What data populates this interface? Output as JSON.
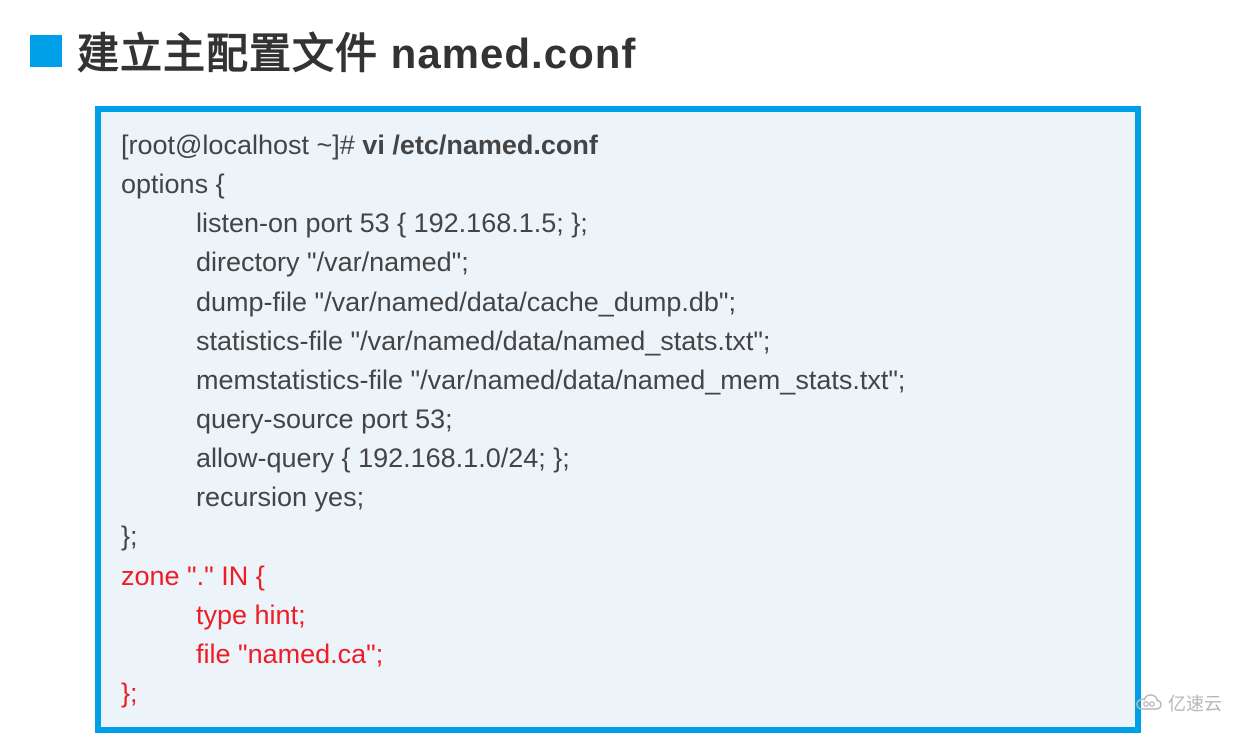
{
  "heading": "建立主配置文件 named.conf",
  "code": {
    "prompt": "[root@localhost ~]# ",
    "command": "vi /etc/named.conf",
    "options_open": "options {",
    "opt_lines": [
      "listen-on port 53 { 192.168.1.5; };",
      "directory  \"/var/named\";",
      "dump-file  \"/var/named/data/cache_dump.db\";",
      "statistics-file  \"/var/named/data/named_stats.txt\";",
      "memstatistics-file  \"/var/named/data/named_mem_stats.txt\";",
      "query-source  port 53;",
      "allow-query  { 192.168.1.0/24; };",
      "recursion  yes;"
    ],
    "options_close": "};",
    "zone_open": "zone \".\" IN {",
    "zone_lines": [
      "type hint;",
      "file \"named.ca\";"
    ],
    "zone_close": "};"
  },
  "watermark": "亿速云"
}
